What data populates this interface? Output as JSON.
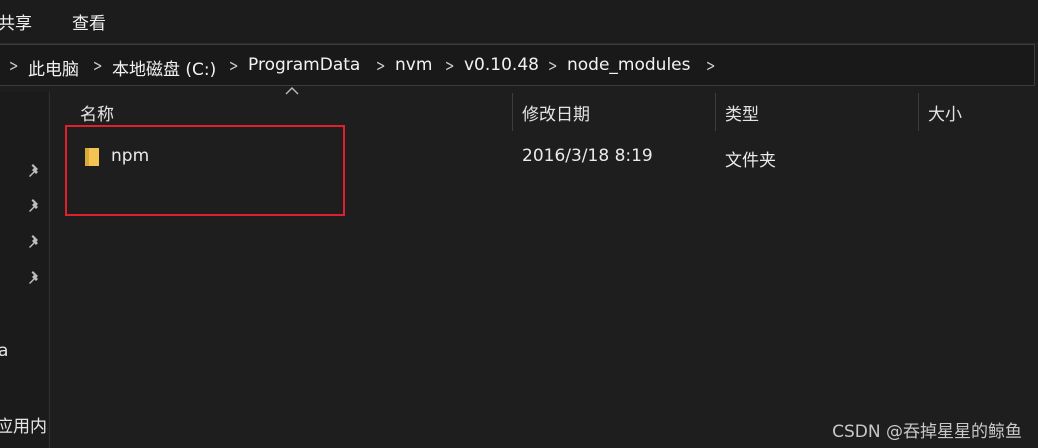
{
  "ribbon": {
    "tabs": [
      "共享",
      "查看"
    ],
    "tab_share": "共享",
    "tab_view": "查看"
  },
  "address": {
    "crumbs": [
      "此电脑",
      "本地磁盘 (C:)",
      "ProgramData",
      "nvm",
      "v0.10.48",
      "node_modules"
    ],
    "c0": "此电脑",
    "c1": "本地磁盘 (C:)",
    "c2": "ProgramData",
    "c3": "nvm",
    "c4": "v0.10.48",
    "c5": "node_modules"
  },
  "nav": {
    "item_a": "a",
    "item_app": "应用内容"
  },
  "columns": {
    "name": "名称",
    "modified": "修改日期",
    "type": "类型",
    "size": "大小"
  },
  "rows": [
    {
      "name": "npm",
      "modified": "2016/3/18 8:19",
      "type": "文件夹",
      "size": ""
    }
  ],
  "watermark": "CSDN @吞掉星星的鲸鱼",
  "colors": {
    "highlight": "#e0202c",
    "folder": "#f3c454"
  },
  "icons": [
    "pin-icon",
    "folder-icon",
    "chevron-right-icon",
    "sort-up-icon"
  ]
}
